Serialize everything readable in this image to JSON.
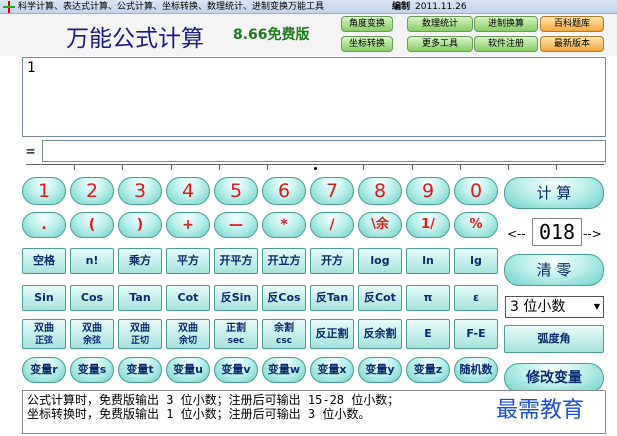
{
  "window": {
    "title": "科学计算、表达式计算、公式计算、坐标转换、数理统计、进制变换万能工具",
    "edition_label": "编制",
    "edition_date": "2011.11.26"
  },
  "header": {
    "app_title": "万能公式计算",
    "version": "8.66免费版"
  },
  "nav": [
    "角度变换",
    "数理统计",
    "进制换算",
    "百科题库",
    "坐标转换",
    "更多工具",
    "软件注册",
    "最新版本"
  ],
  "input": {
    "value": "1"
  },
  "result": {
    "prefix": "=",
    "value": ""
  },
  "keys": {
    "row1": [
      "1",
      "2",
      "3",
      "4",
      "5",
      "6",
      "7",
      "8",
      "9",
      "0"
    ],
    "row2": [
      ".",
      "(",
      ")",
      "+",
      "—",
      "*",
      "/",
      "\\余",
      "1/",
      "%"
    ],
    "row3": [
      "空格",
      "n!",
      "乘方",
      "平方",
      "开平方",
      "开立方",
      "开方",
      "log",
      "ln",
      "lg"
    ],
    "row4": [
      "Sin",
      "Cos",
      "Tan",
      "Cot",
      "反Sin",
      "反Cos",
      "反Tan",
      "反Cot",
      "π",
      "ε"
    ],
    "row5a": [
      "双曲",
      "双曲",
      "双曲",
      "双曲",
      "正割",
      "余割",
      "反正割",
      "反余割",
      "E",
      "F-E"
    ],
    "row5b": [
      "正弦",
      "余弦",
      "正切",
      "余切",
      "sec",
      "csc",
      "",
      "",
      "",
      ""
    ],
    "row6": [
      "变量r",
      "变量s",
      "变量t",
      "变量u",
      "变量v",
      "变量w",
      "变量x",
      "变量y",
      "变量z",
      "随机数"
    ]
  },
  "side": {
    "calc": "计 算",
    "precision_left": "<--",
    "precision_value": "018",
    "precision_right": "-->",
    "clear": "清 零",
    "digits_select": "3 位小数",
    "angle_mode": "弧度角",
    "edit_vars": "修改变量"
  },
  "note": {
    "line1": "公式计算时，免费版输出 3 位小数；注册后可输出 15-28 位小数；",
    "line2": "坐标转换时，免费版输出 1 位小数；注册后可输出 3 位小数。"
  },
  "watermark": "最需教育"
}
